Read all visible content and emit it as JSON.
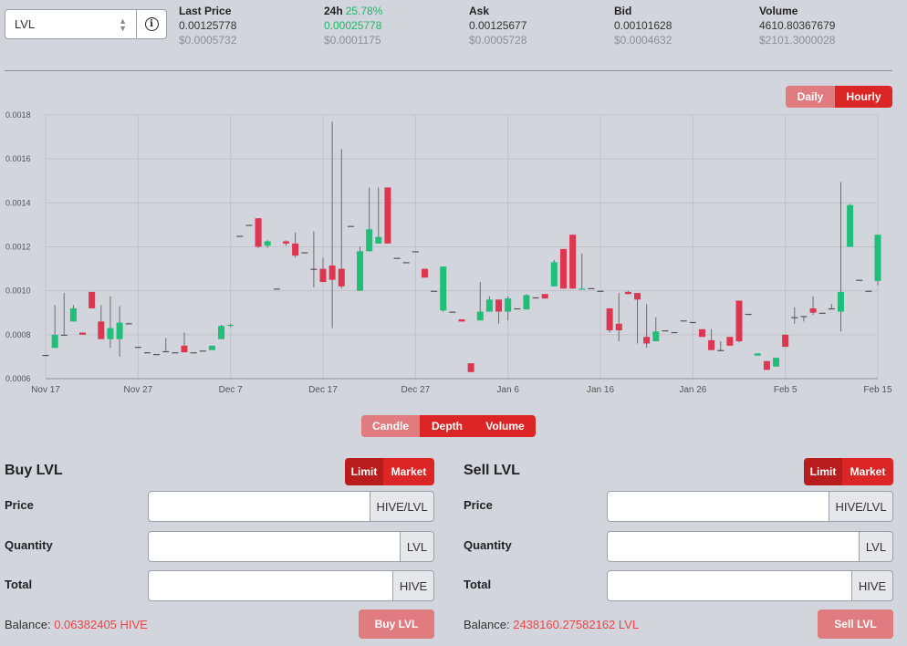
{
  "token_select": {
    "value": "LVL"
  },
  "stats": [
    {
      "label": "Last Price",
      "change": "",
      "value": "0.00125778",
      "usd": "$0.0005732",
      "value_color": "normal"
    },
    {
      "label": "24h",
      "change": "25.78%",
      "value": "0.00025778",
      "usd": "$0.0001175",
      "value_color": "green"
    },
    {
      "label": "Ask",
      "change": "",
      "value": "0.00125677",
      "usd": "$0.0005728",
      "value_color": "normal"
    },
    {
      "label": "Bid",
      "change": "",
      "value": "0.00101628",
      "usd": "$0.0004632",
      "value_color": "normal"
    },
    {
      "label": "Volume",
      "change": "",
      "value": "4610.80367679",
      "usd": "$2101.3000028",
      "value_color": "normal"
    }
  ],
  "interval_toggle": {
    "daily": "Daily",
    "hourly": "Hourly",
    "active": "hourly"
  },
  "chart_toggle": {
    "candle": "Candle",
    "depth": "Depth",
    "volume": "Volume"
  },
  "colors": {
    "up": "#1fbf7a",
    "down": "#de3551",
    "accent": "#dc2626",
    "accent_light": "#e07b7f",
    "background": "#d3d5dc"
  },
  "chart_data": {
    "type": "candlestick",
    "ylim": [
      0.0006,
      0.0018
    ],
    "y_ticks": [
      "0.0018",
      "0.0016",
      "0.0014",
      "0.0012",
      "0.0010",
      "0.0008",
      "0.0006"
    ],
    "x_ticks": [
      "Nov 17",
      "Nov 27",
      "Dec 7",
      "Dec 17",
      "Dec 27",
      "Jan 6",
      "Jan 16",
      "Jan 26",
      "Feb 5",
      "Feb 15"
    ],
    "x_start": "Nov 17",
    "grid": true,
    "candles": [
      {
        "day": 0,
        "o": 0.000708,
        "h": 0.000708,
        "l": 0.000708,
        "c": 0.000708
      },
      {
        "day": 1,
        "o": 0.00074,
        "h": 0.000935,
        "l": 0.00074,
        "c": 0.0008
      },
      {
        "day": 2,
        "o": 0.0008,
        "h": 0.00099,
        "l": 0.0008,
        "c": 0.0008
      },
      {
        "day": 3,
        "o": 0.00086,
        "h": 0.000935,
        "l": 0.00086,
        "c": 0.00092
      },
      {
        "day": 4,
        "o": 0.00081,
        "h": 0.00081,
        "l": 0.0008,
        "c": 0.0008
      },
      {
        "day": 5,
        "o": 0.000995,
        "h": 0.000995,
        "l": 0.00092,
        "c": 0.00092
      },
      {
        "day": 6,
        "o": 0.00086,
        "h": 0.000935,
        "l": 0.00078,
        "c": 0.00078
      },
      {
        "day": 7,
        "o": 0.00078,
        "h": 0.000975,
        "l": 0.00074,
        "c": 0.00083
      },
      {
        "day": 8,
        "o": 0.00078,
        "h": 0.00093,
        "l": 0.0007,
        "c": 0.000855
      },
      {
        "day": 9,
        "o": 0.000852,
        "h": 0.000855,
        "l": 0.00085,
        "c": 0.000852
      },
      {
        "day": 10,
        "o": 0.000745,
        "h": 0.000745,
        "l": 0.000745,
        "c": 0.000745
      },
      {
        "day": 11,
        "o": 0.00072,
        "h": 0.00072,
        "l": 0.00072,
        "c": 0.00072
      },
      {
        "day": 12,
        "o": 0.000712,
        "h": 0.000712,
        "l": 0.000712,
        "c": 0.000712
      },
      {
        "day": 13,
        "o": 0.000725,
        "h": 0.000785,
        "l": 0.000725,
        "c": 0.000725
      },
      {
        "day": 14,
        "o": 0.00072,
        "h": 0.00072,
        "l": 0.00072,
        "c": 0.00072
      },
      {
        "day": 15,
        "o": 0.00075,
        "h": 0.00081,
        "l": 0.00072,
        "c": 0.00072
      },
      {
        "day": 16,
        "o": 0.00072,
        "h": 0.00072,
        "l": 0.00072,
        "c": 0.00072
      },
      {
        "day": 17,
        "o": 0.000728,
        "h": 0.000728,
        "l": 0.000728,
        "c": 0.000728
      },
      {
        "day": 18,
        "o": 0.00073,
        "h": 0.00075,
        "l": 0.00073,
        "c": 0.00075
      },
      {
        "day": 19,
        "o": 0.00078,
        "h": 0.000845,
        "l": 0.00078,
        "c": 0.00084
      },
      {
        "day": 20,
        "o": 0.00084,
        "h": 0.00085,
        "l": 0.000835,
        "c": 0.000845
      },
      {
        "day": 21,
        "o": 0.00125,
        "h": 0.00125,
        "l": 0.00125,
        "c": 0.00125
      },
      {
        "day": 22,
        "o": 0.0013,
        "h": 0.0013,
        "l": 0.0013,
        "c": 0.0013
      },
      {
        "day": 23,
        "o": 0.00133,
        "h": 0.00133,
        "l": 0.001195,
        "c": 0.0012
      },
      {
        "day": 24,
        "o": 0.001205,
        "h": 0.00123,
        "l": 0.001195,
        "c": 0.001225
      },
      {
        "day": 25,
        "o": 0.00101,
        "h": 0.00101,
        "l": 0.00101,
        "c": 0.00101
      },
      {
        "day": 26,
        "o": 0.001225,
        "h": 0.00123,
        "l": 0.001205,
        "c": 0.001215
      },
      {
        "day": 27,
        "o": 0.001215,
        "h": 0.001265,
        "l": 0.00115,
        "c": 0.00116
      },
      {
        "day": 28,
        "o": 0.001175,
        "h": 0.001175,
        "l": 0.001175,
        "c": 0.001175
      },
      {
        "day": 29,
        "o": 0.0011,
        "h": 0.00127,
        "l": 0.001015,
        "c": 0.0011
      },
      {
        "day": 30,
        "o": 0.0011,
        "h": 0.00115,
        "l": 0.00104,
        "c": 0.00104
      },
      {
        "day": 31,
        "o": 0.001115,
        "h": 0.00177,
        "l": 0.00083,
        "c": 0.00105
      },
      {
        "day": 32,
        "o": 0.0011,
        "h": 0.001645,
        "l": 0.00101,
        "c": 0.00102
      },
      {
        "day": 33,
        "o": 0.001295,
        "h": 0.001295,
        "l": 0.001295,
        "c": 0.001295
      },
      {
        "day": 34,
        "o": 0.001,
        "h": 0.0012,
        "l": 0.001,
        "c": 0.00118
      },
      {
        "day": 35,
        "o": 0.00118,
        "h": 0.00147,
        "l": 0.00118,
        "c": 0.00128
      },
      {
        "day": 36,
        "o": 0.001215,
        "h": 0.00147,
        "l": 0.001215,
        "c": 0.001245
      },
      {
        "day": 37,
        "o": 0.00147,
        "h": 0.00147,
        "l": 0.001215,
        "c": 0.001215
      },
      {
        "day": 38,
        "o": 0.00115,
        "h": 0.00115,
        "l": 0.00115,
        "c": 0.00115
      },
      {
        "day": 39,
        "o": 0.00113,
        "h": 0.00113,
        "l": 0.00113,
        "c": 0.00113
      },
      {
        "day": 40,
        "o": 0.00118,
        "h": 0.00118,
        "l": 0.00118,
        "c": 0.00118
      },
      {
        "day": 41,
        "o": 0.0011,
        "h": 0.0011,
        "l": 0.00106,
        "c": 0.00106
      },
      {
        "day": 42,
        "o": 0.001,
        "h": 0.001,
        "l": 0.001,
        "c": 0.001
      },
      {
        "day": 43,
        "o": 0.00091,
        "h": 0.00111,
        "l": 0.000905,
        "c": 0.00111
      },
      {
        "day": 44,
        "o": 0.000905,
        "h": 0.000905,
        "l": 0.000905,
        "c": 0.000905
      },
      {
        "day": 45,
        "o": 0.00087,
        "h": 0.00087,
        "l": 0.00086,
        "c": 0.00086
      },
      {
        "day": 46,
        "o": 0.00067,
        "h": 0.00067,
        "l": 0.00063,
        "c": 0.00063
      },
      {
        "day": 47,
        "o": 0.000865,
        "h": 0.00104,
        "l": 0.000865,
        "c": 0.000905
      },
      {
        "day": 48,
        "o": 0.000905,
        "h": 0.000975,
        "l": 0.000905,
        "c": 0.00096
      },
      {
        "day": 49,
        "o": 0.00096,
        "h": 0.00096,
        "l": 0.00085,
        "c": 0.000905
      },
      {
        "day": 50,
        "o": 0.000905,
        "h": 0.000975,
        "l": 0.000865,
        "c": 0.000965
      },
      {
        "day": 51,
        "o": 0.00092,
        "h": 0.00092,
        "l": 0.00092,
        "c": 0.00092
      },
      {
        "day": 52,
        "o": 0.000915,
        "h": 0.000985,
        "l": 0.000915,
        "c": 0.00098
      },
      {
        "day": 53,
        "o": 0.00097,
        "h": 0.00097,
        "l": 0.00097,
        "c": 0.00097
      },
      {
        "day": 54,
        "o": 0.000985,
        "h": 0.000985,
        "l": 0.000965,
        "c": 0.000965
      },
      {
        "day": 55,
        "o": 0.00102,
        "h": 0.00114,
        "l": 0.00102,
        "c": 0.00113
      },
      {
        "day": 56,
        "o": 0.00119,
        "h": 0.00119,
        "l": 0.00101,
        "c": 0.00101
      },
      {
        "day": 57,
        "o": 0.001255,
        "h": 0.001255,
        "l": 0.00101,
        "c": 0.00101
      },
      {
        "day": 58,
        "o": 0.001005,
        "h": 0.00117,
        "l": 0.001005,
        "c": 0.00101
      },
      {
        "day": 59,
        "o": 0.001012,
        "h": 0.001012,
        "l": 0.001012,
        "c": 0.001012
      },
      {
        "day": 60,
        "o": 0.001,
        "h": 0.001,
        "l": 0.001,
        "c": 0.001
      },
      {
        "day": 61,
        "o": 0.00092,
        "h": 0.00092,
        "l": 0.00081,
        "c": 0.00082
      },
      {
        "day": 62,
        "o": 0.00085,
        "h": 0.00099,
        "l": 0.00077,
        "c": 0.00082
      },
      {
        "day": 63,
        "o": 0.000995,
        "h": 0.001,
        "l": 0.000985,
        "c": 0.000985
      },
      {
        "day": 64,
        "o": 0.00099,
        "h": 0.00099,
        "l": 0.00076,
        "c": 0.00096
      },
      {
        "day": 65,
        "o": 0.00079,
        "h": 0.00094,
        "l": 0.00074,
        "c": 0.00076
      },
      {
        "day": 66,
        "o": 0.00077,
        "h": 0.00088,
        "l": 0.00077,
        "c": 0.000815
      },
      {
        "day": 67,
        "o": 0.00082,
        "h": 0.00082,
        "l": 0.00082,
        "c": 0.00082
      },
      {
        "day": 68,
        "o": 0.000812,
        "h": 0.000812,
        "l": 0.000812,
        "c": 0.000812
      },
      {
        "day": 69,
        "o": 0.000865,
        "h": 0.000865,
        "l": 0.000865,
        "c": 0.000865
      },
      {
        "day": 70,
        "o": 0.000858,
        "h": 0.000858,
        "l": 0.000858,
        "c": 0.000858
      },
      {
        "day": 71,
        "o": 0.000825,
        "h": 0.000825,
        "l": 0.00079,
        "c": 0.00079
      },
      {
        "day": 72,
        "o": 0.000775,
        "h": 0.000825,
        "l": 0.00073,
        "c": 0.00073
      },
      {
        "day": 73,
        "o": 0.00073,
        "h": 0.00077,
        "l": 0.000725,
        "c": 0.00073
      },
      {
        "day": 74,
        "o": 0.00079,
        "h": 0.00079,
        "l": 0.00075,
        "c": 0.00075
      },
      {
        "day": 75,
        "o": 0.000955,
        "h": 0.000955,
        "l": 0.000765,
        "c": 0.00077
      },
      {
        "day": 76,
        "o": 0.000895,
        "h": 0.000895,
        "l": 0.000895,
        "c": 0.000895
      },
      {
        "day": 77,
        "o": 0.000705,
        "h": 0.000715,
        "l": 0.000705,
        "c": 0.000715
      },
      {
        "day": 78,
        "o": 0.00068,
        "h": 0.00068,
        "l": 0.00064,
        "c": 0.00064
      },
      {
        "day": 79,
        "o": 0.000655,
        "h": 0.000695,
        "l": 0.000655,
        "c": 0.000695
      },
      {
        "day": 80,
        "o": 0.0008,
        "h": 0.0008,
        "l": 0.000745,
        "c": 0.000745
      },
      {
        "day": 81,
        "o": 0.00088,
        "h": 0.000925,
        "l": 0.00085,
        "c": 0.00088
      },
      {
        "day": 82,
        "o": 0.000885,
        "h": 0.000885,
        "l": 0.00086,
        "c": 0.000885
      },
      {
        "day": 83,
        "o": 0.00092,
        "h": 0.000975,
        "l": 0.00089,
        "c": 0.0009
      },
      {
        "day": 84,
        "o": 0.0009,
        "h": 0.0009,
        "l": 0.0009,
        "c": 0.0009
      },
      {
        "day": 85,
        "o": 0.00092,
        "h": 0.00094,
        "l": 0.00092,
        "c": 0.00092
      },
      {
        "day": 86,
        "o": 0.000905,
        "h": 0.001495,
        "l": 0.000815,
        "c": 0.000995
      },
      {
        "day": 87,
        "o": 0.0012,
        "h": 0.001395,
        "l": 0.0012,
        "c": 0.00139
      },
      {
        "day": 88,
        "o": 0.00105,
        "h": 0.00105,
        "l": 0.00105,
        "c": 0.00105
      },
      {
        "day": 89,
        "o": 0.001,
        "h": 0.001,
        "l": 0.001,
        "c": 0.001
      },
      {
        "day": 90,
        "o": 0.001045,
        "h": 0.001255,
        "l": 0.001025,
        "c": 0.001255
      }
    ]
  },
  "buy_panel": {
    "title": "Buy LVL",
    "limit": "Limit",
    "market": "Market",
    "price_label": "Price",
    "price_unit": "HIVE/LVL",
    "quantity_label": "Quantity",
    "quantity_unit": "LVL",
    "total_label": "Total",
    "total_unit": "HIVE",
    "balance_label": "Balance:",
    "balance_value": "0.06382405 HIVE",
    "button": "Buy LVL"
  },
  "sell_panel": {
    "title": "Sell LVL",
    "limit": "Limit",
    "market": "Market",
    "price_label": "Price",
    "price_unit": "HIVE/LVL",
    "quantity_label": "Quantity",
    "quantity_unit": "LVL",
    "total_label": "Total",
    "total_unit": "HIVE",
    "balance_label": "Balance:",
    "balance_value": "2438160.27582162 LVL",
    "button": "Sell LVL"
  }
}
